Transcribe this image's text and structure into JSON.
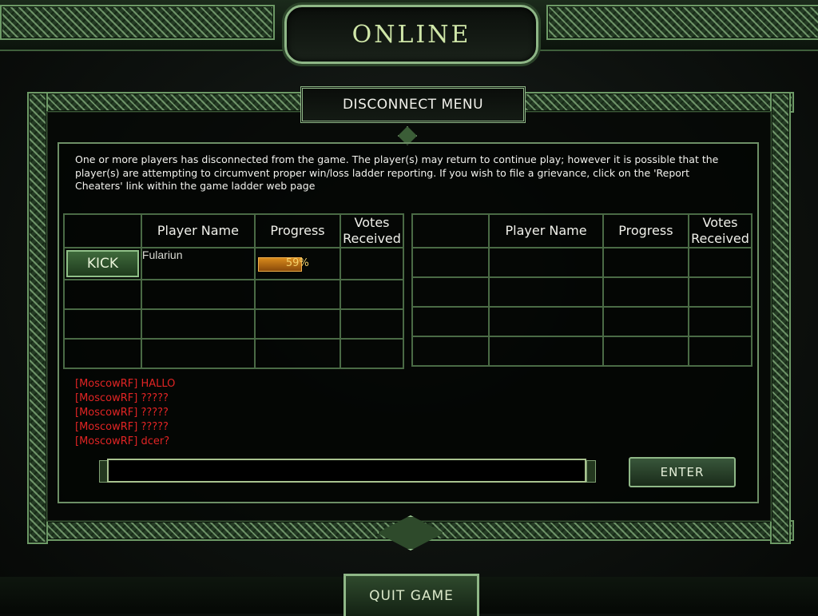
{
  "header": {
    "title": "ONLINE"
  },
  "dialog": {
    "title": "DISCONNECT MENU",
    "notice": "One or more players has disconnected from the game.  The player(s) may return to continue play; however it is possible that the player(s) are attempting to circumvent proper win/loss ladder reporting.  If you wish to file a grievance, click on the 'Report Cheaters' link within the game ladder web page"
  },
  "table": {
    "headers": {
      "name": "Player Name",
      "progress": "Progress",
      "votes": "Votes Received"
    },
    "kick_label": "KICK",
    "players": [
      {
        "name": "Fulariun",
        "progress_text": "59%",
        "progress": 0.59
      }
    ]
  },
  "chat": {
    "messages": [
      "[MoscowRF] HALLO",
      "[MoscowRF] ?????",
      "[MoscowRF] ?????",
      "[MoscowRF] ?????",
      "[MoscowRF] dcer?"
    ],
    "input_value": "",
    "enter_label": "ENTER"
  },
  "footer": {
    "quit_label": "QUIT GAME"
  },
  "colors": {
    "frame": "#8fb787",
    "chat_text": "#e12424",
    "progress": "#d88a1c"
  }
}
